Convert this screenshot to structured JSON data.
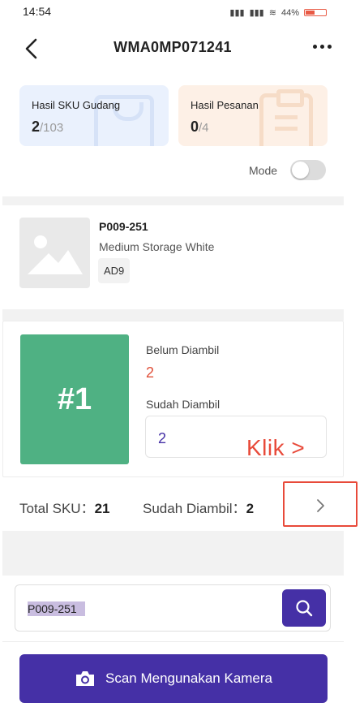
{
  "status_bar": {
    "time": "14:54",
    "battery": "44%"
  },
  "header": {
    "title": "WMA0MP071241",
    "back_icon": "chevron-left-icon",
    "more_icon": "more-horizontal-icon"
  },
  "summary": {
    "sku_card": {
      "label": "Hasil SKU Gudang",
      "done": "2",
      "total": "/103",
      "icon": "shopping-bag-icon",
      "color": "#eaf1fd"
    },
    "order_card": {
      "label": "Hasil Pesanan",
      "done": "0",
      "total": "/4",
      "icon": "clipboard-icon",
      "color": "#fdf0e6"
    }
  },
  "mode": {
    "label": "Mode",
    "enabled": false
  },
  "product": {
    "code": "P009-251",
    "name": "Medium Storage White",
    "location": "AD9",
    "image_icon": "image-placeholder-icon"
  },
  "pick": {
    "rank": "#1",
    "rank_color": "#4fb183",
    "not_picked_label": "Belum Diambil",
    "not_picked_value": "2",
    "picked_label": "Sudah Diambil",
    "picked_value": "2",
    "annotation": "Klik >"
  },
  "totals": {
    "sku_label": "Total SKU：",
    "sku_value": "21",
    "picked_label": "Sudah Diambil：",
    "picked_value": "2",
    "next_icon": "chevron-right-icon"
  },
  "search": {
    "value": "P009-251",
    "button_icon": "search-icon"
  },
  "camera_button": {
    "label": "Scan Mengunakan Kamera",
    "icon": "camera-icon"
  },
  "colors": {
    "primary": "#4530a6",
    "danger": "#e0503a",
    "success": "#4fb183",
    "annotation": "#e84a3a"
  }
}
